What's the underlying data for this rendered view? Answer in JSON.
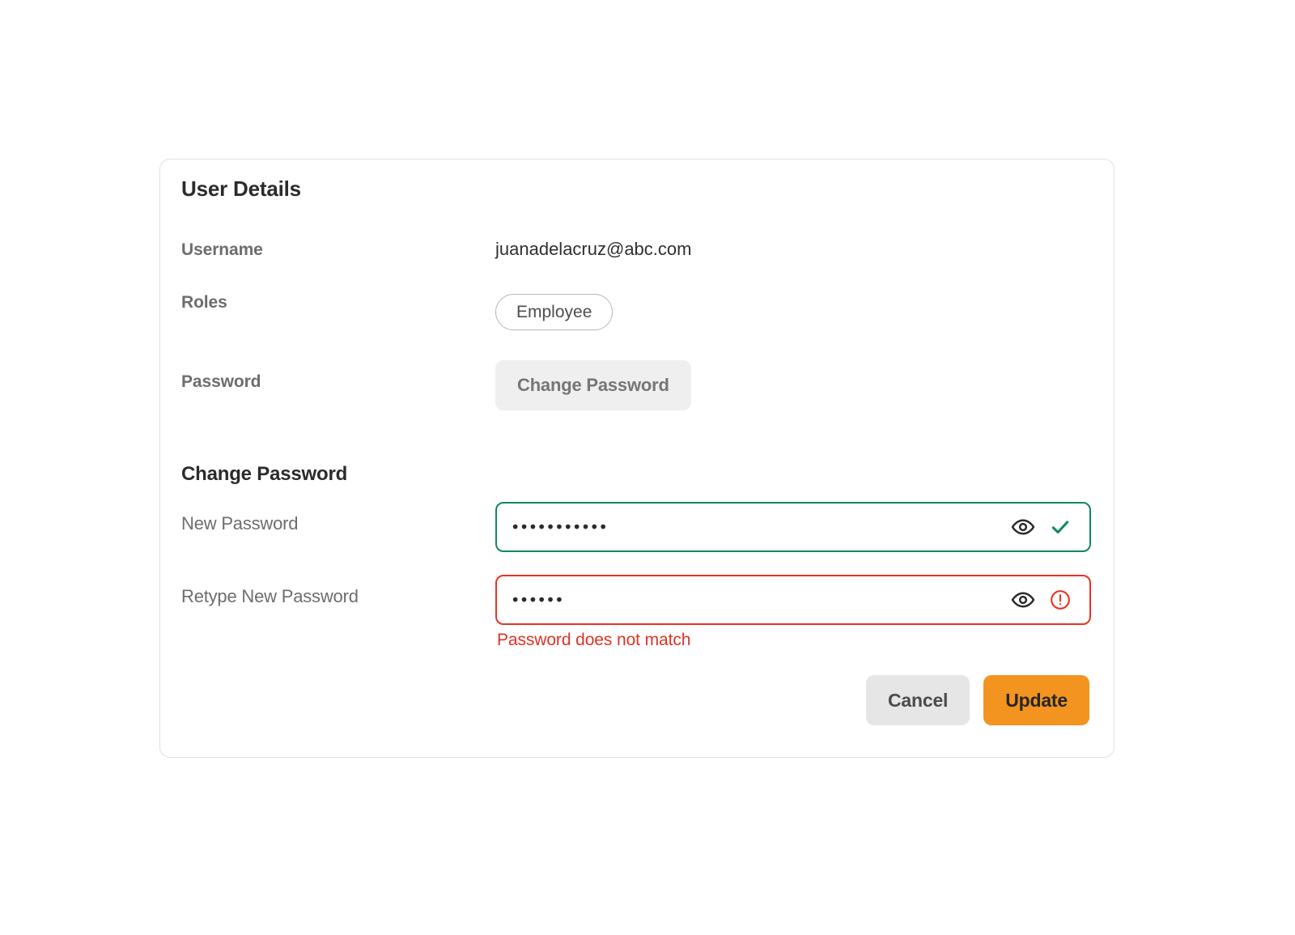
{
  "card": {
    "title": "User Details"
  },
  "details": {
    "username": {
      "label": "Username",
      "value": "juanadelacruz@abc.com"
    },
    "roles": {
      "label": "Roles",
      "chip": "Employee"
    },
    "password": {
      "label": "Password",
      "button": "Change Password"
    }
  },
  "change_password": {
    "section_title": "Change Password",
    "new_password": {
      "label": "New Password",
      "masked_value": "•••••••••••",
      "char_count": 11,
      "state": "valid"
    },
    "retype_password": {
      "label": "Retype New Password",
      "masked_value": "••••••",
      "char_count": 6,
      "state": "invalid",
      "error_message": "Password does not match"
    },
    "icons": {
      "toggle_visibility": "eye-icon",
      "valid_status": "check-icon",
      "invalid_status": "error-circle-icon"
    }
  },
  "footer": {
    "cancel_label": "Cancel",
    "update_label": "Update"
  },
  "colors": {
    "accent_orange": "#F2941F",
    "valid_green": "#12885E",
    "error_red": "#EB3223",
    "error_text_red": "#E13226",
    "muted_gray": "#6D6D6D",
    "card_border": "#E2E2E2",
    "button_gray": "#E6E6E6",
    "disabled_button_bg": "#EFEFEF"
  }
}
